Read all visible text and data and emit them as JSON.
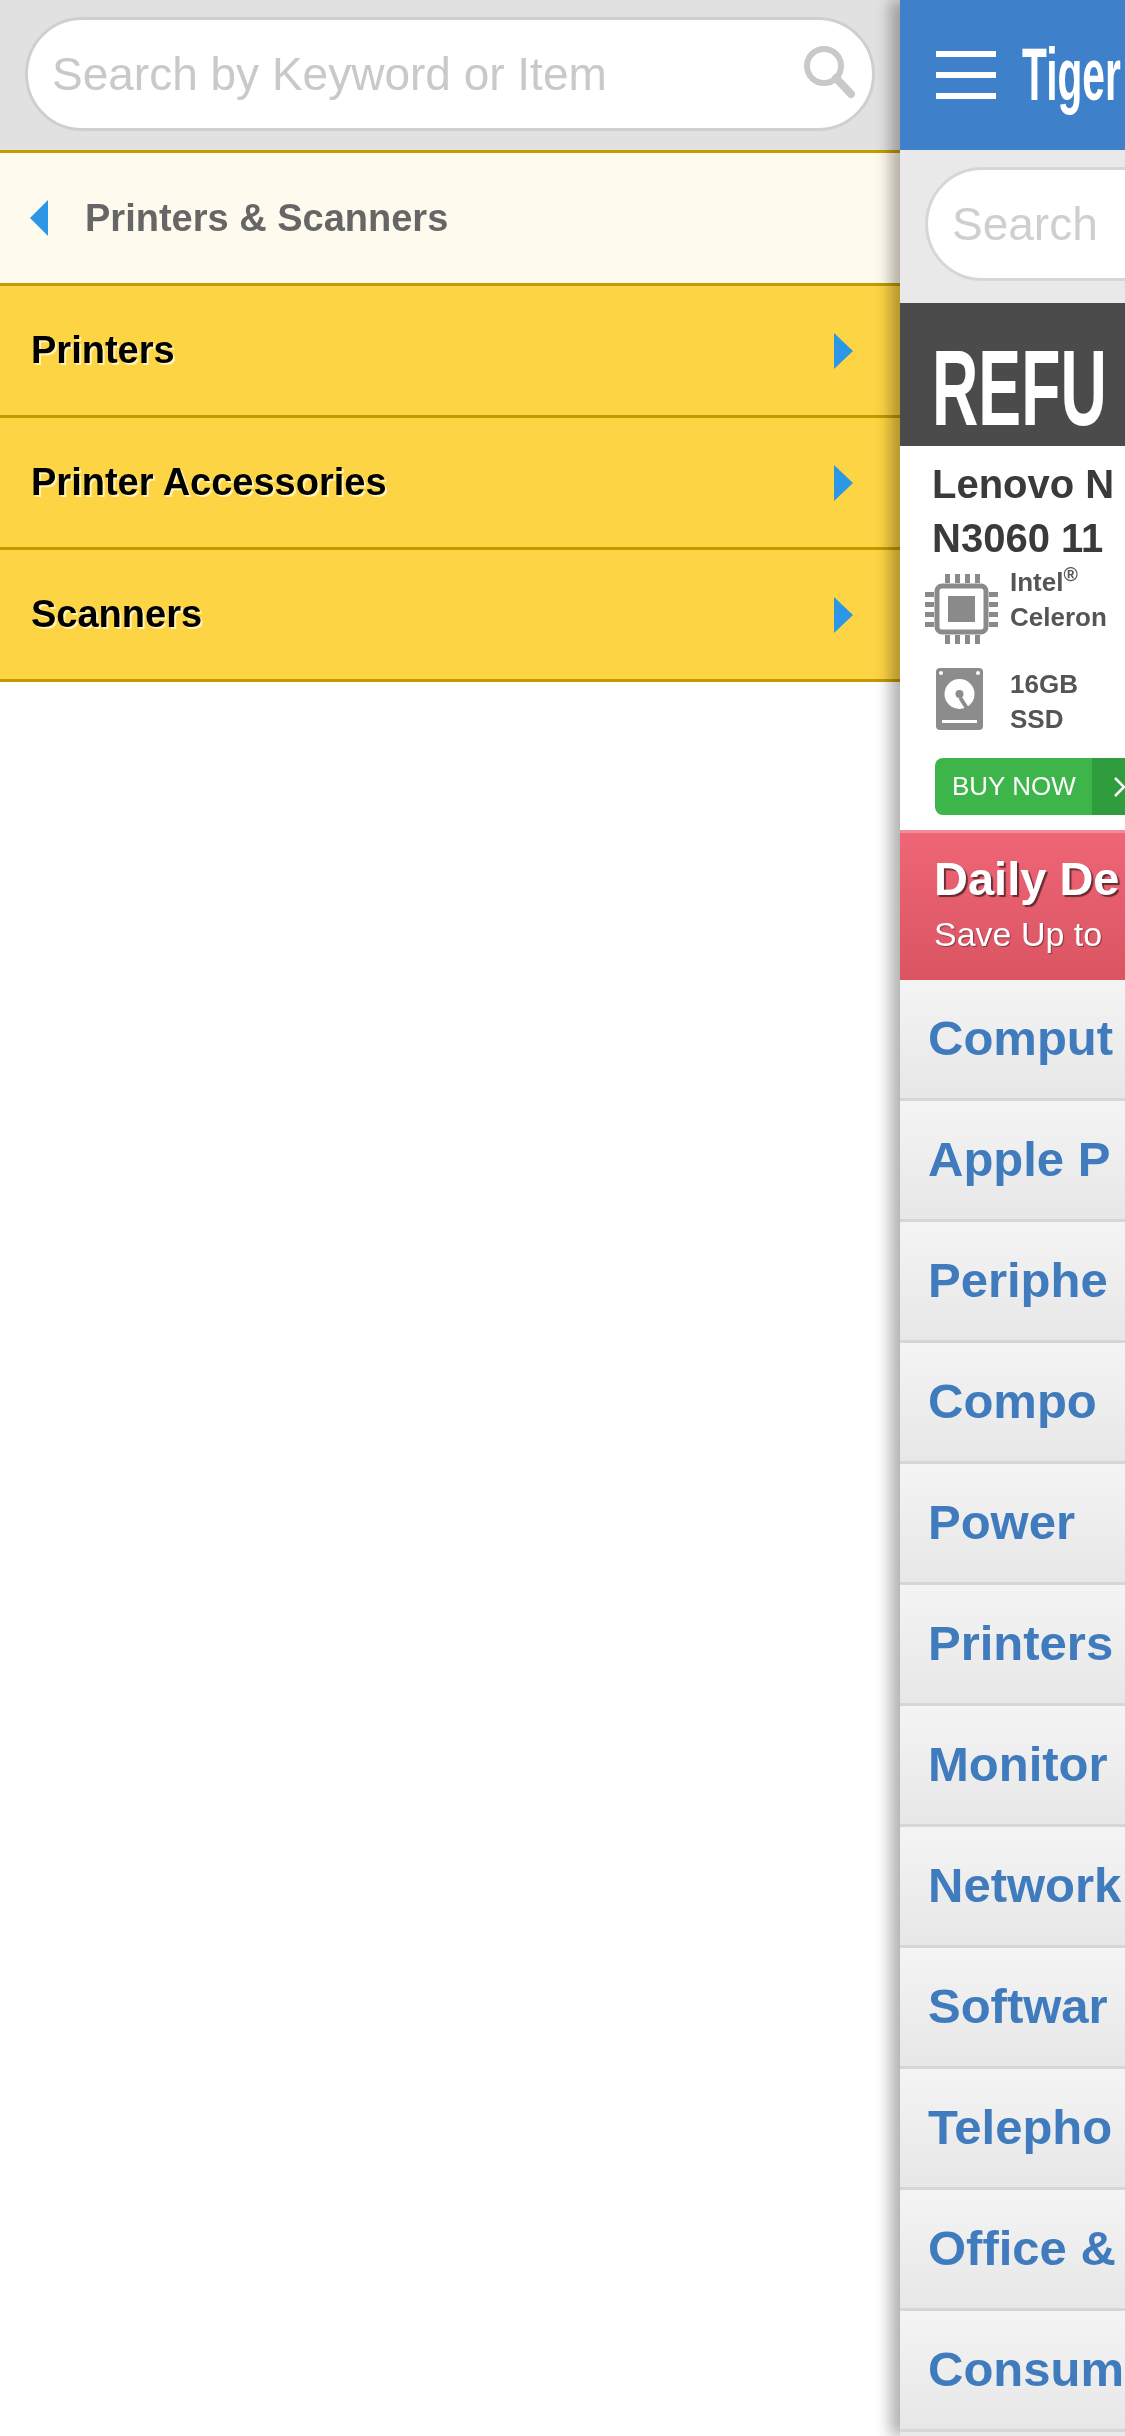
{
  "side_menu": {
    "search": {
      "placeholder": "Search by Keyword or Item"
    },
    "back": {
      "label": "Printers & Scanners"
    },
    "items": [
      {
        "label": "Printers"
      },
      {
        "label": "Printer Accessories"
      },
      {
        "label": "Scanners"
      }
    ]
  },
  "page": {
    "header": {
      "logo": "Tiger"
    },
    "search": {
      "placeholder": "Search"
    },
    "banner": {
      "title": "REFU"
    },
    "product": {
      "title_lines": [
        "Lenovo N",
        "N3060 11"
      ],
      "specs": [
        {
          "kind": "cpu",
          "lines": [
            "Intel$^{®}$",
            "Celeron"
          ]
        },
        {
          "kind": "storage",
          "lines": [
            "16GB",
            "SSD"
          ]
        }
      ],
      "button": {
        "label": "BUY NOW"
      }
    },
    "promo": {
      "title": "Daily De",
      "subtitle": "Save Up to"
    },
    "categories": [
      {
        "label": "Comput"
      },
      {
        "label": "Apple P"
      },
      {
        "label": "Periphe"
      },
      {
        "label": "Compo"
      },
      {
        "label": "Power"
      },
      {
        "label": "Printers"
      },
      {
        "label": "Monitor"
      },
      {
        "label": "Network"
      },
      {
        "label": "Softwar"
      },
      {
        "label": "Telepho"
      },
      {
        "label": "Office &"
      },
      {
        "label": "Consum"
      }
    ]
  }
}
